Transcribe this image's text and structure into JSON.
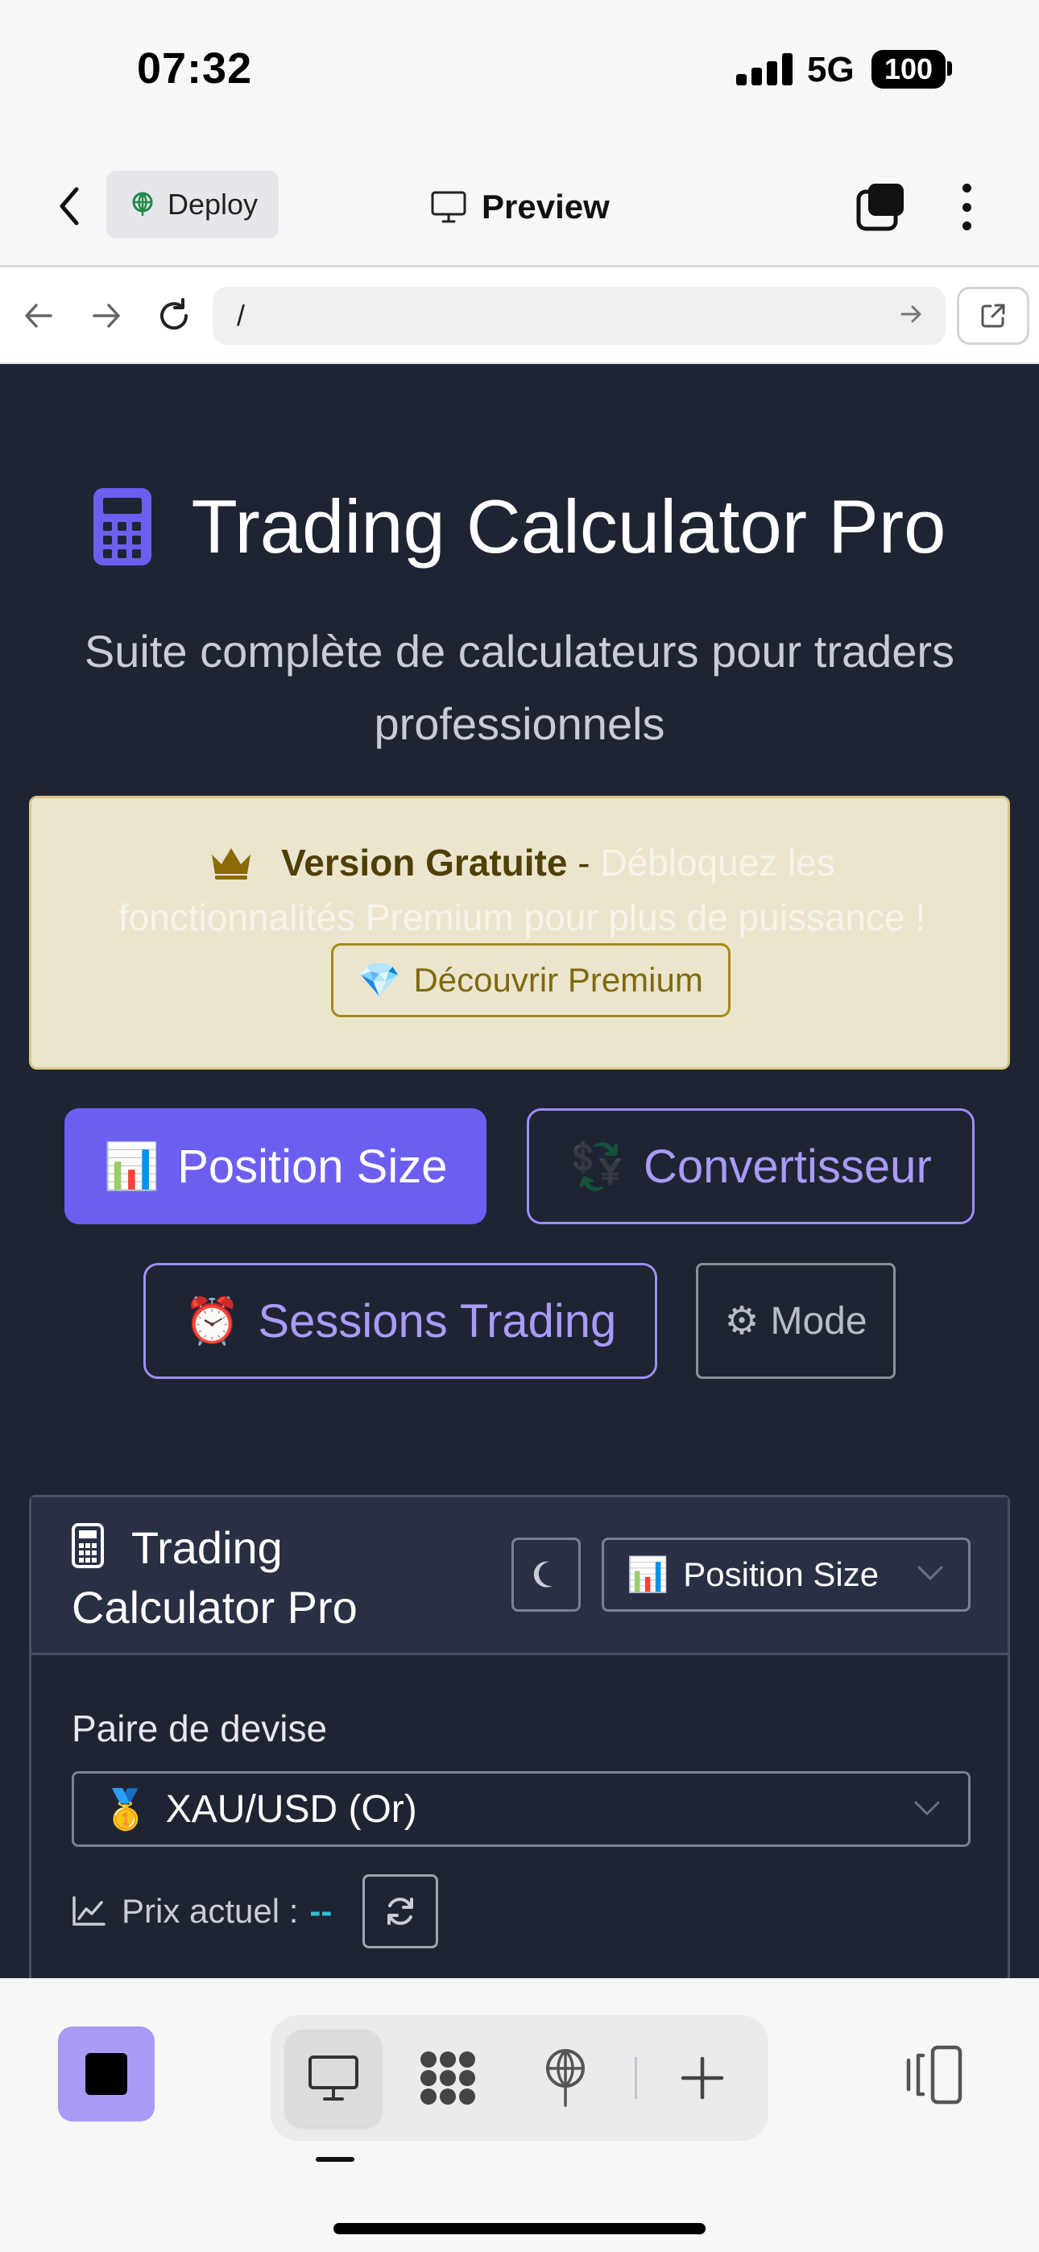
{
  "status_bar": {
    "time": "07:32",
    "network": "5G",
    "battery": "100"
  },
  "app_header": {
    "deploy_label": "Deploy",
    "preview_label": "Preview"
  },
  "url_bar": {
    "url": "/"
  },
  "page": {
    "title": "Trading Calculator Pro",
    "subtitle": "Suite complète de calculateurs pour traders professionnels",
    "banner": {
      "bold": "Version Gratuite",
      "dash": "-",
      "text_line1": "Débloquez les",
      "text_line2": "fonctionnalités Premium pour plus de puissance !",
      "button_label": "Découvrir Premium",
      "button_icon": "💎"
    },
    "tabs": [
      {
        "icon": "📊",
        "label": "Position Size",
        "active": true
      },
      {
        "icon": "💱",
        "label": "Convertisseur",
        "active": false
      },
      {
        "icon": "⏰",
        "label": "Sessions Trading",
        "active": false
      }
    ],
    "mode_button": {
      "icon": "⚙",
      "label": "Mode"
    },
    "calculator": {
      "title": "Trading Calculator Pro",
      "mode_select": {
        "icon": "📊",
        "value": "Position Size"
      },
      "pair_label": "Paire de devise",
      "pair_select": {
        "icon": "🥇",
        "value": "XAU/USD (Or)"
      },
      "price_label": "Prix actuel :",
      "price_value": "--"
    }
  },
  "colors": {
    "content_bg": "#1f2433",
    "accent": "#6c5ff0",
    "accent_outline": "#9c8ff4",
    "banner_bg": "#ebe5cd",
    "price_value": "#2fc0d8"
  }
}
